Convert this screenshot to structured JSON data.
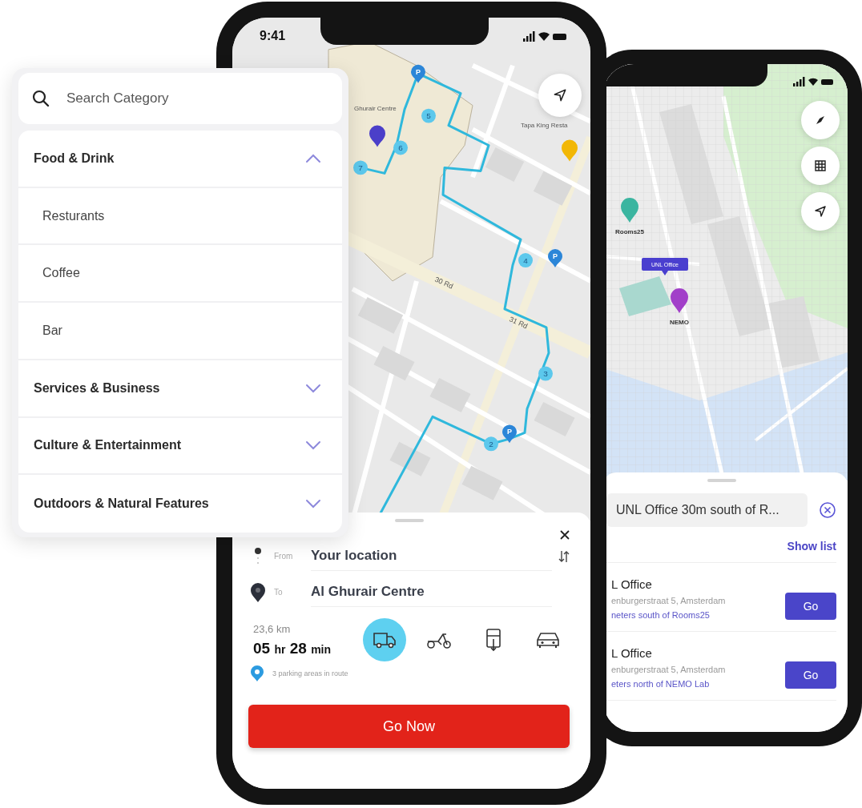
{
  "category_panel": {
    "search": {
      "placeholder": "Search Category"
    },
    "categories": [
      {
        "label": "Food & Drink",
        "expanded": true,
        "children": [
          {
            "label": "Resturants"
          },
          {
            "label": "Coffee"
          },
          {
            "label": "Bar"
          }
        ]
      },
      {
        "label": "Services & Business",
        "expanded": false
      },
      {
        "label": "Culture & Entertainment",
        "expanded": false
      },
      {
        "label": "Outdoors & Natural Features",
        "expanded": false
      }
    ]
  },
  "route_phone": {
    "status_bar": {
      "time": "9:41"
    },
    "map": {
      "labels": [
        "Ghurair Centre",
        "Tapa King Resta",
        "30 Rd",
        "31 Rd"
      ],
      "route_stops": [
        "2",
        "3",
        "4",
        "5",
        "6",
        "7"
      ],
      "parking_markers": [
        "P",
        "P",
        "P"
      ]
    },
    "directions": {
      "from_label": "From",
      "from_value": "Your location",
      "to_label": "To",
      "to_value": "Al Ghurair Centre",
      "distance": "23,6 km",
      "hours": "05",
      "hours_unit": "hr",
      "minutes": "28",
      "minutes_unit": "min",
      "parking_note": "3 parking areas in route",
      "modes": [
        {
          "kind": "truck",
          "selected": true
        },
        {
          "kind": "scooter",
          "selected": false
        },
        {
          "kind": "tram",
          "selected": false
        },
        {
          "kind": "car",
          "selected": false
        }
      ],
      "primary_button": "Go Now"
    }
  },
  "places_phone": {
    "map": {
      "pins": [
        {
          "label": "Rooms25",
          "color": "#3bb5a0"
        },
        {
          "label": "NEMO",
          "color": "#a23fc9"
        }
      ],
      "callout": "UNL Office"
    },
    "search": {
      "value": "UNL Office 30m south of R..."
    },
    "show_list": "Show list",
    "results": [
      {
        "title": "L Office",
        "address": "enburgerstraat 5, Amsterdam",
        "distance": "neters south of Rooms25",
        "button": "Go"
      },
      {
        "title": "L Office",
        "address": "enburgerstraat 5, Amsterdam",
        "distance": "eters north of NEMO Lab",
        "button": "Go"
      }
    ]
  }
}
